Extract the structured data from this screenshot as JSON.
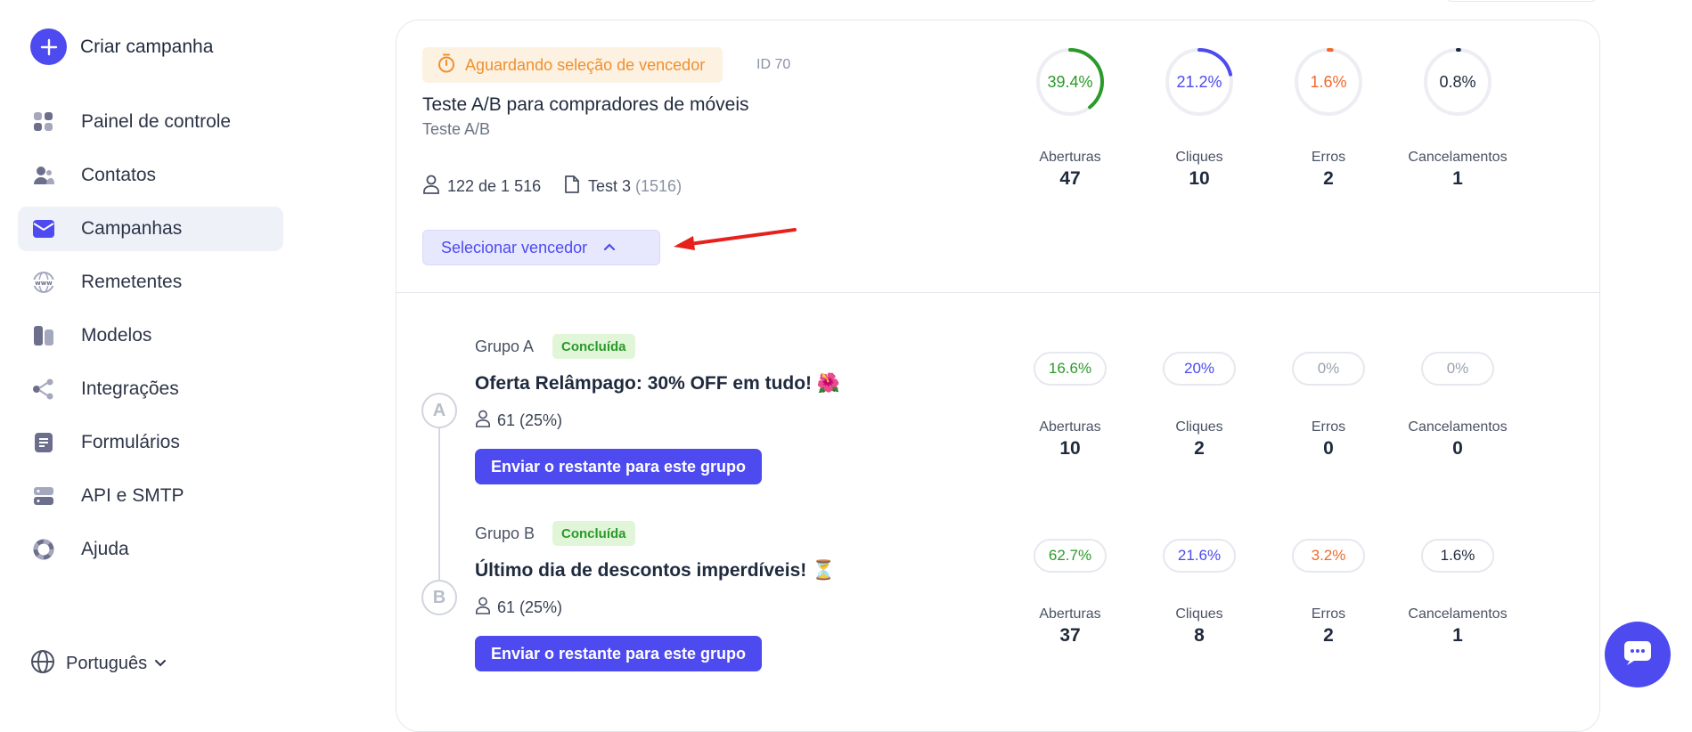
{
  "sidebar": {
    "create_label": "Criar campanha",
    "items": [
      {
        "label": "Painel de controle",
        "icon": "dashboard-icon"
      },
      {
        "label": "Contatos",
        "icon": "contacts-icon"
      },
      {
        "label": "Campanhas",
        "icon": "campaigns-icon",
        "active": true
      },
      {
        "label": "Remetentes",
        "icon": "www-icon"
      },
      {
        "label": "Modelos",
        "icon": "templates-icon"
      },
      {
        "label": "Integrações",
        "icon": "integrations-icon"
      },
      {
        "label": "Formulários",
        "icon": "forms-icon"
      },
      {
        "label": "API e SMTP",
        "icon": "server-icon"
      },
      {
        "label": "Ajuda",
        "icon": "help-icon"
      }
    ],
    "language": "Português"
  },
  "campaign": {
    "status": "Aguardando seleção de vencedor",
    "id": "ID 70",
    "title": "Teste A/B para compradores de móveis",
    "type": "Teste A/B",
    "recipients": "122 de 1 516",
    "list_name": "Test 3",
    "list_count": "(1516)",
    "select_winner_label": "Selecionar vencedor",
    "stats": [
      {
        "pct": "39.4%",
        "fraction": 0.394,
        "color": "#2b9a2a",
        "label": "Aberturas",
        "value": "47"
      },
      {
        "pct": "21.2%",
        "fraction": 0.212,
        "color": "#4d4bf0",
        "label": "Cliques",
        "value": "10"
      },
      {
        "pct": "1.6%",
        "fraction": 0.016,
        "color": "#f06a2c",
        "label": "Erros",
        "value": "2"
      },
      {
        "pct": "0.8%",
        "fraction": 0.008,
        "color": "#1f2a3d",
        "label": "Cancelamentos",
        "value": "1"
      }
    ]
  },
  "groups": [
    {
      "letter": "A",
      "name": "Grupo A",
      "status": "Concluída",
      "subject": "Oferta Relâmpago: 30% OFF em tudo! 🌺",
      "recipients": "61 (25%)",
      "send_label": "Enviar o restante para este grupo",
      "stats": [
        {
          "pct": "16.6%",
          "color": "#2b9a2a",
          "label": "Aberturas",
          "value": "10"
        },
        {
          "pct": "20%",
          "color": "#4d4bf0",
          "label": "Cliques",
          "value": "2"
        },
        {
          "pct": "0%",
          "color": "#9aa1b0",
          "label": "Erros",
          "value": "0"
        },
        {
          "pct": "0%",
          "color": "#9aa1b0",
          "label": "Cancelamentos",
          "value": "0"
        }
      ]
    },
    {
      "letter": "B",
      "name": "Grupo B",
      "status": "Concluída",
      "subject": "Último dia de descontos imperdíveis! ⏳",
      "recipients": "61 (25%)",
      "send_label": "Enviar o restante para este grupo",
      "stats": [
        {
          "pct": "62.7%",
          "color": "#2b9a2a",
          "label": "Aberturas",
          "value": "37"
        },
        {
          "pct": "21.6%",
          "color": "#4d4bf0",
          "label": "Cliques",
          "value": "8"
        },
        {
          "pct": "3.2%",
          "color": "#f06a2c",
          "label": "Erros",
          "value": "2"
        },
        {
          "pct": "1.6%",
          "color": "#1f2a3d",
          "label": "Cancelamentos",
          "value": "1"
        }
      ]
    }
  ]
}
